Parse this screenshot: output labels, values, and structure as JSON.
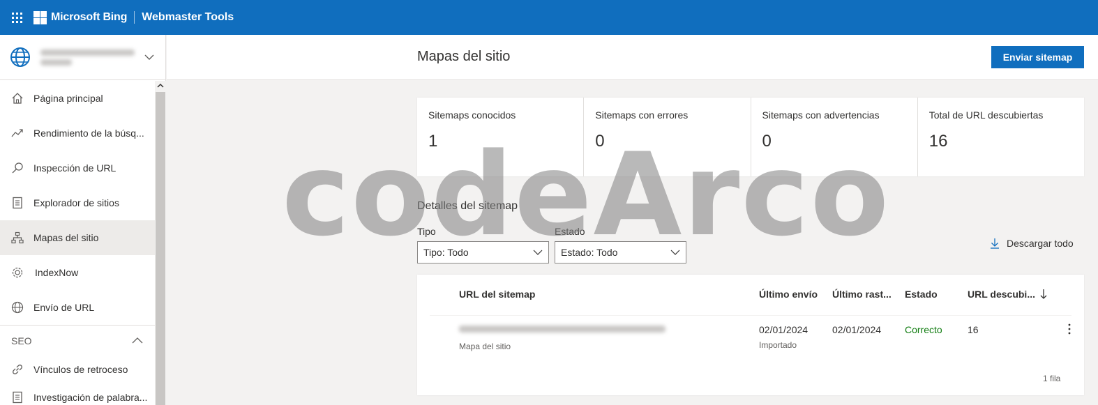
{
  "topbar": {
    "brand": "Microsoft Bing",
    "product": "Webmaster Tools"
  },
  "sidebar": {
    "items": [
      {
        "label": "Página principal",
        "icon": "home-icon"
      },
      {
        "label": "Rendimiento de la búsq...",
        "icon": "trend-icon"
      },
      {
        "label": "Inspección de URL",
        "icon": "search-icon"
      },
      {
        "label": "Explorador de sitios",
        "icon": "document-icon"
      },
      {
        "label": "Mapas del sitio",
        "icon": "sitemap-icon",
        "active": true
      },
      {
        "label": "IndexNow",
        "icon": "gear-icon"
      },
      {
        "label": "Envío de URL",
        "icon": "globe-icon"
      }
    ],
    "section": "SEO",
    "seo_items": [
      {
        "label": "Vínculos de retroceso",
        "icon": "link-icon"
      },
      {
        "label": "Investigación de palabra...",
        "icon": "document-icon"
      }
    ]
  },
  "header": {
    "title": "Mapas del sitio",
    "submit_label": "Enviar sitemap"
  },
  "stats": [
    {
      "label": "Sitemaps conocidos",
      "value": "1"
    },
    {
      "label": "Sitemaps con errores",
      "value": "0"
    },
    {
      "label": "Sitemaps con advertencias",
      "value": "0"
    },
    {
      "label": "Total de URL descubiertas",
      "value": "16"
    }
  ],
  "details": {
    "title": "Detalles del sitemap",
    "filters": {
      "type_label": "Tipo",
      "type_value": "Tipo: Todo",
      "status_label": "Estado",
      "status_value": "Estado: Todo"
    },
    "download_label": "Descargar todo"
  },
  "table": {
    "columns": [
      "URL del sitemap",
      "Último envío",
      "Último rast...",
      "Estado",
      "URL descubi..."
    ],
    "rows": [
      {
        "type": "Mapa del sitio",
        "last_submitted": "02/01/2024",
        "submit_method": "Importado",
        "last_crawled": "02/01/2024",
        "status": "Correcto",
        "urls": "16"
      }
    ],
    "row_count": "1 fila"
  },
  "watermark": "codeArco",
  "colors": {
    "accent": "#106ebe",
    "success": "#107c10"
  }
}
